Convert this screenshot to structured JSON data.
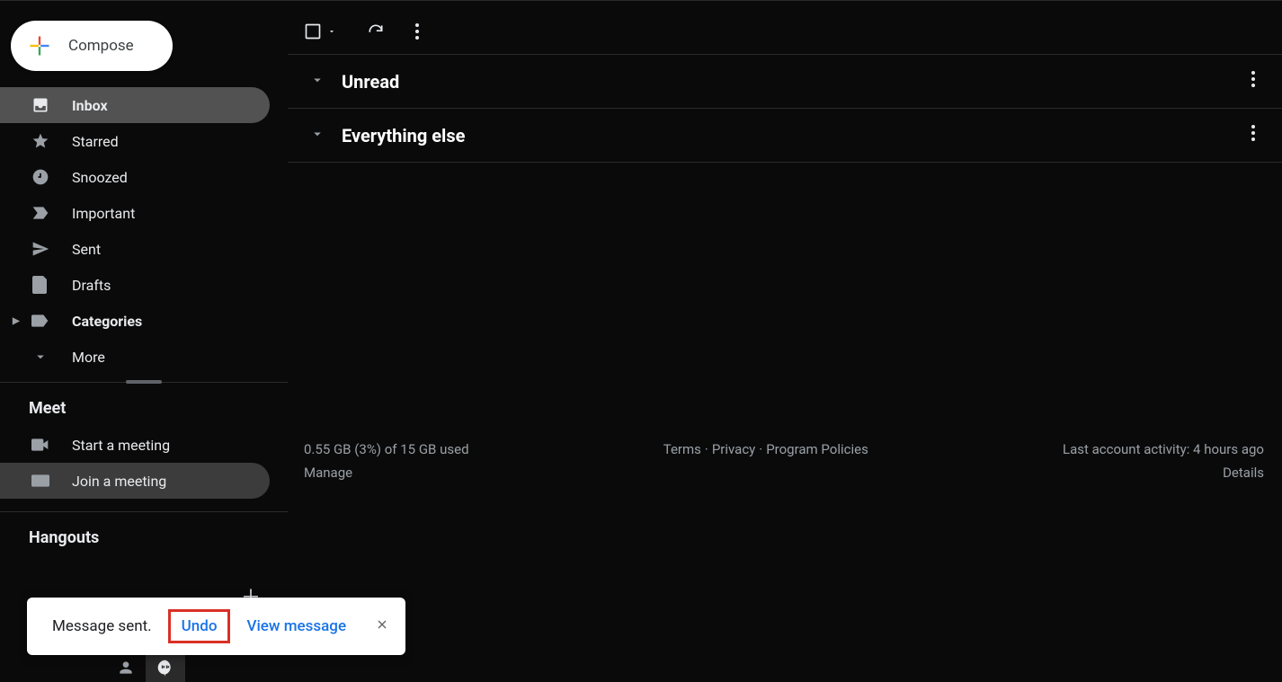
{
  "compose": {
    "label": "Compose"
  },
  "nav": {
    "inbox": "Inbox",
    "starred": "Starred",
    "snoozed": "Snoozed",
    "important": "Important",
    "sent": "Sent",
    "drafts": "Drafts",
    "categories": "Categories",
    "more": "More"
  },
  "meet": {
    "title": "Meet",
    "start": "Start a meeting",
    "join": "Join a meeting"
  },
  "hangouts": {
    "title": "Hangouts"
  },
  "sections": {
    "unread": "Unread",
    "everything_else": "Everything else"
  },
  "footer": {
    "storage": "0.55 GB (3%) of 15 GB used",
    "manage": "Manage",
    "terms": "Terms",
    "privacy": "Privacy",
    "policies": "Program Policies",
    "activity": "Last account activity: 4 hours ago",
    "details": "Details"
  },
  "toast": {
    "message": "Message sent.",
    "undo": "Undo",
    "view": "View message"
  }
}
